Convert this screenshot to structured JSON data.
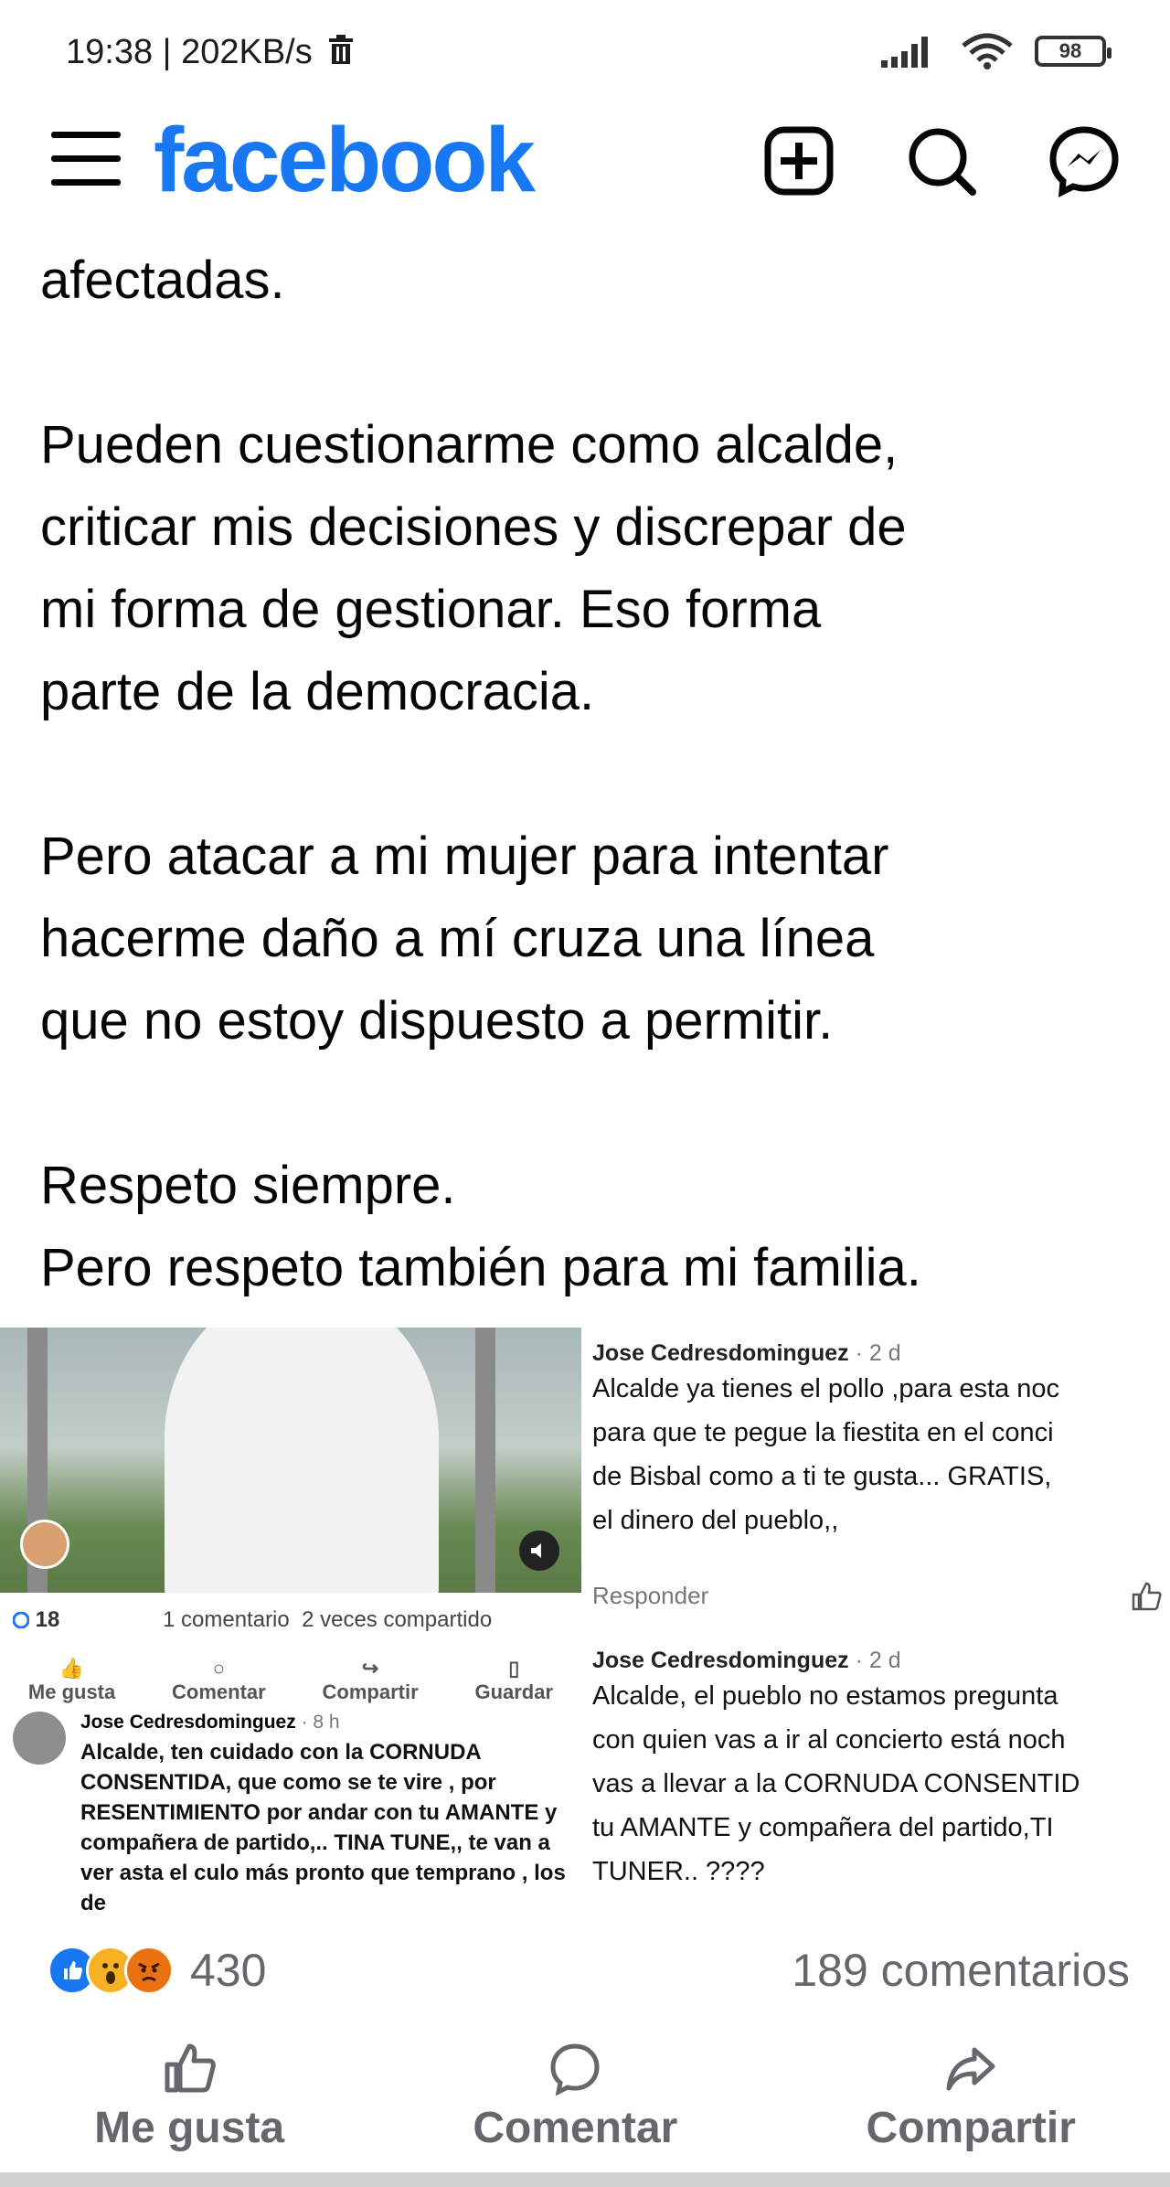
{
  "status": {
    "time": "19:38 | 202KB/s",
    "battery": "98"
  },
  "header": {
    "logo": "facebook"
  },
  "post": {
    "paragraphs": [
      [
        "afectadas."
      ],
      [
        "Pueden cuestionarme como alcalde,",
        "criticar mis decisiones y discrepar de",
        "mi forma de gestionar. Eso forma",
        "parte de la democracia."
      ],
      [
        "Pero atacar a mi mujer para intentar",
        "hacerme daño a mí cruza una línea",
        "que no estoy dispuesto a permitir."
      ],
      [
        "Respeto siempre.",
        "Pero respeto también para mi familia."
      ]
    ]
  },
  "embedded": {
    "left": {
      "reactions": "18",
      "stats": "1 comentario  2 veces compartido",
      "actions": [
        "Me gusta",
        "Comentar",
        "Compartir",
        "Guardar"
      ],
      "comment": {
        "author": "Jose Cedresdominguez",
        "time": "· 8 h",
        "text": "Alcalde, ten cuidado con la CORNUDA CONSENTIDA, que como se te vire , por RESENTIMIENTO por andar con tu AMANTE y compañera de  partido,.. TINA TUNE,, te van a ver asta el culo más pronto que temprano , los de"
      }
    },
    "right": {
      "comments": [
        {
          "author": "Jose Cedresdominguez",
          "time": "· 2 d",
          "lines": [
            "Alcalde ya tienes el pollo ,para esta noc",
            "para que te pegue la fiestita en el conci",
            "de Bisbal como a ti te gusta... GRATIS,",
            "el dinero del pueblo,,"
          ]
        },
        {
          "author": "Jose Cedresdominguez",
          "time": "· 2 d",
          "lines": [
            "Alcalde, el pueblo no estamos pregunta",
            "con quien vas a ir al concierto está noch",
            "vas a llevar a la CORNUDA CONSENTID",
            "tu AMANTE y compañera del partido,TI",
            "TUNER.. ????"
          ]
        }
      ],
      "reply": "Responder"
    }
  },
  "footer": {
    "reaction_count": "430",
    "comment_count": "189 comentarios",
    "actions": {
      "like": "Me gusta",
      "comment": "Comentar",
      "share": "Compartir"
    }
  },
  "colors": {
    "brand": "#1877f2",
    "like": "#1877f2",
    "wow": "#f7b125",
    "angry": "#e9710f",
    "muted": "#65676b"
  }
}
